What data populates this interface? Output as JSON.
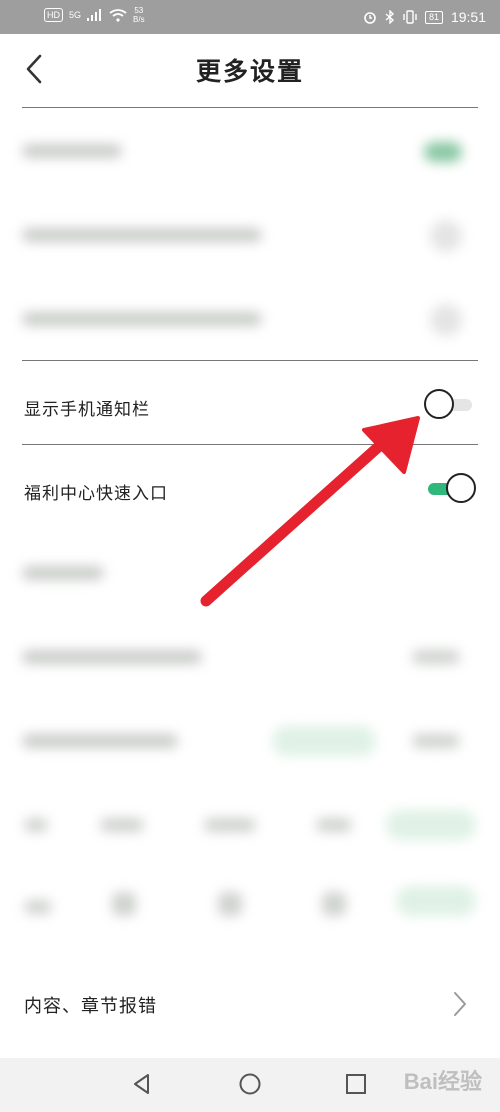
{
  "status_bar": {
    "hd_badge": "HD",
    "signal_label": "5G",
    "speed_value": "53",
    "speed_unit": "B/s",
    "battery": "81",
    "time": "19:51"
  },
  "header": {
    "title": "更多设置"
  },
  "settings": [
    {
      "label": "显示手机通知栏",
      "state": "off"
    },
    {
      "label": "福利中心快速入口",
      "state": "on"
    }
  ],
  "report": {
    "label": "内容、章节报错"
  },
  "watermark": "Bai经验",
  "colors": {
    "accent_green": "#2fb87a",
    "arrow_red": "#e5222d",
    "status_bar_bg": "#9e9e9e"
  },
  "icons": {
    "back": "chevron-left-icon",
    "report": "chevron-right-icon",
    "nav_back": "triangle-back-icon",
    "nav_home": "circle-home-icon",
    "nav_recent": "square-recent-icon"
  }
}
